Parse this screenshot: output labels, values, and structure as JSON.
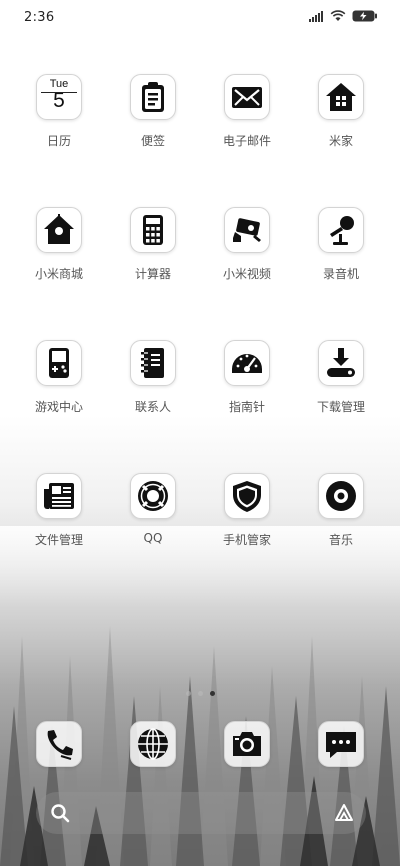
{
  "status_bar": {
    "time": "2:36",
    "icons": [
      "signal-icon",
      "wifi-icon",
      "battery-charging-icon"
    ]
  },
  "apps": [
    {
      "label": "日历",
      "icon": "calendar-icon",
      "weekday": "Tue",
      "day": "5"
    },
    {
      "label": "便签",
      "icon": "clipboard-icon"
    },
    {
      "label": "电子邮件",
      "icon": "envelope-icon"
    },
    {
      "label": "米家",
      "icon": "home-icon"
    },
    {
      "label": "小米商城",
      "icon": "birdhouse-icon"
    },
    {
      "label": "计算器",
      "icon": "calculator-icon"
    },
    {
      "label": "小米视频",
      "icon": "video-camera-icon"
    },
    {
      "label": "录音机",
      "icon": "microphone-icon"
    },
    {
      "label": "游戏中心",
      "icon": "gameboy-icon"
    },
    {
      "label": "联系人",
      "icon": "address-book-icon"
    },
    {
      "label": "指南针",
      "icon": "gauge-icon"
    },
    {
      "label": "下载管理",
      "icon": "download-icon"
    },
    {
      "label": "文件管理",
      "icon": "newspaper-icon"
    },
    {
      "label": "QQ",
      "icon": "lifebuoy-icon"
    },
    {
      "label": "手机管家",
      "icon": "shield-icon"
    },
    {
      "label": "音乐",
      "icon": "disc-icon"
    }
  ],
  "page_indicator": {
    "pages": 3,
    "active": 3
  },
  "dock": [
    {
      "icon": "phone-icon"
    },
    {
      "icon": "globe-icon"
    },
    {
      "icon": "camera-icon"
    },
    {
      "icon": "message-icon"
    }
  ],
  "search_bar": {
    "left_icon": "search-icon",
    "right_icon": "assistant-icon"
  }
}
